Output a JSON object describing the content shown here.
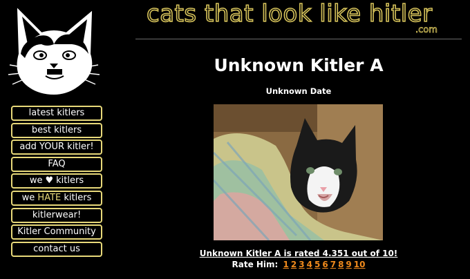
{
  "site": {
    "title": "cats that look like hitler",
    "tld": ".com"
  },
  "nav": {
    "items": [
      {
        "label": "latest kitlers"
      },
      {
        "label": "best kitlers"
      },
      {
        "label": "add YOUR kitler!"
      },
      {
        "label": "FAQ"
      },
      {
        "label_pre": "we",
        "label_icon": "heart-icon",
        "label_post": "kitlers"
      },
      {
        "label_pre": "we",
        "label_hl": "HATE",
        "label_post": "kitlers"
      },
      {
        "label": "kitlerwear!"
      },
      {
        "label": "Kitler Community"
      },
      {
        "label": "contact us"
      }
    ]
  },
  "kitler": {
    "name": "Unknown Kitler A",
    "date": "Unknown Date",
    "rating_text": "Unknown Kitler A is rated 4.351 out of 10!",
    "rate_label": "Rate Him:",
    "rate_options": [
      "1",
      "2",
      "3",
      "4",
      "5",
      "6",
      "7",
      "8",
      "9",
      "10"
    ]
  },
  "colors": {
    "accent": "#e8d97a",
    "link": "#f08a1c",
    "background": "#000000"
  }
}
